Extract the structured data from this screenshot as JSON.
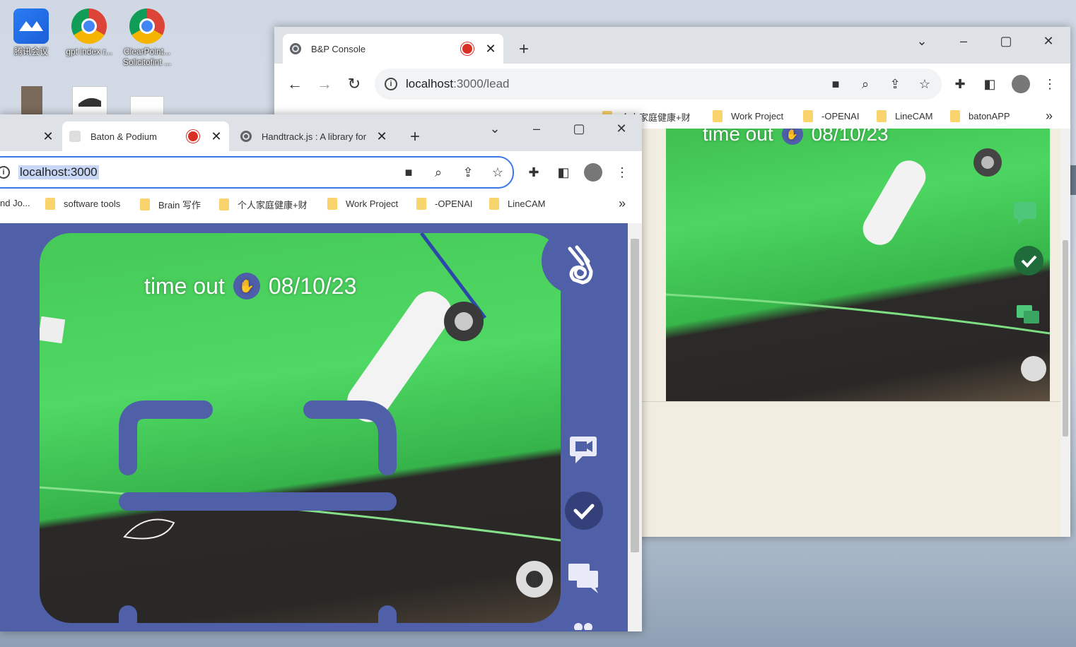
{
  "desktop": {
    "icons": [
      {
        "label": "腾讯会议",
        "icon": "tencent-meeting-icon"
      },
      {
        "label": "gpt index r...",
        "icon": "chrome-icon"
      },
      {
        "label": "ClearPoint... Solicitofint ...",
        "icon": "chrome-icon"
      }
    ]
  },
  "back_window": {
    "tab_title": "B&P Console",
    "url_host": "localhost",
    "url_path": ":3000/lead",
    "bookmarks": [
      "个人家庭健康+财",
      "Work Project",
      "-OPENAI",
      "LineCAM",
      "batonAPP"
    ],
    "overlay_word": "time out",
    "overlay_date": "08/10/23"
  },
  "front_window": {
    "tab_left_title": "",
    "tab_active_title": "Baton & Podium",
    "tab_other_title": "Handtrack.js : A library for",
    "url": "localhost:3000",
    "bookmarks": [
      "nd Jo...",
      "software tools",
      "Brain 写作",
      "个人家庭健康+财",
      "Work Project",
      "-OPENAI",
      "LineCAM"
    ],
    "overlay_word": "time out",
    "overlay_date": "08/10/23"
  },
  "colors": {
    "accent": "#5060a8",
    "check_dark": "#33407a",
    "green_check": "#1f6b3a"
  }
}
